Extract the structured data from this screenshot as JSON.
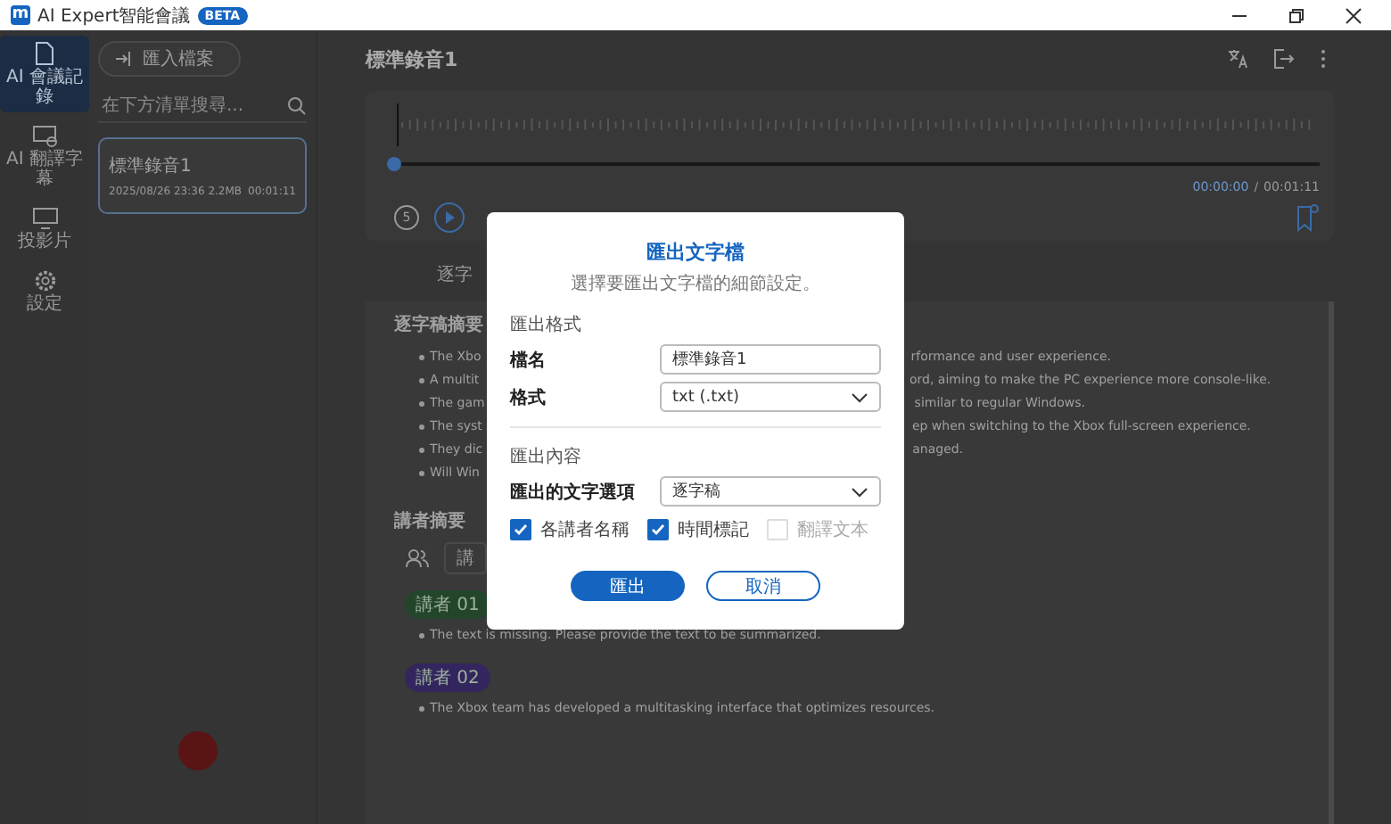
{
  "app": {
    "logo": "m",
    "title": "AI Expert智能會議",
    "badge": "BETA"
  },
  "nav": [
    {
      "label": "AI 會議記錄",
      "selected": true
    },
    {
      "label": "AI 翻譯字幕",
      "selected": false
    },
    {
      "label": "投影片",
      "selected": false
    },
    {
      "label": "設定",
      "selected": false
    }
  ],
  "list": {
    "import_button": "匯入檔案",
    "search": {
      "placeholder": "在下方清單搜尋..."
    },
    "recordings": [
      {
        "name": "標準錄音1",
        "meta": "2025/08/26 23:36 2.2MB",
        "duration": "00:01:11",
        "selected": true
      }
    ]
  },
  "recording": {
    "title": "標準錄音1",
    "player": {
      "level": 0,
      "current": "00:00:00",
      "separator": "/",
      "total": "00:01:11",
      "replay": "5"
    },
    "tab": "逐字",
    "summary": {
      "heading": "逐字稿摘要",
      "bullets": [
        {
          "start": "The Xbo",
          "end": "rformance and user experience."
        },
        {
          "start": "A multit",
          "end": "ord, aiming to make the PC experience more console-like."
        },
        {
          "start": "The gam",
          "end": "similar to regular Windows."
        },
        {
          "start": "The syst",
          "end": "ep when switching to the Xbox full-screen experience."
        },
        {
          "start": "They dic",
          "end": "anaged."
        },
        {
          "start": "Will Win"
        }
      ]
    },
    "speakers": {
      "heading": "講者摘要",
      "field_text": "講",
      "items": [
        {
          "tag": "講者 01",
          "color": "#23452a",
          "bullets": [
            "The text is missing. Please provide the text to be summarized."
          ]
        },
        {
          "tag": "講者 02",
          "color": "#33265e",
          "bullets": [
            "The Xbox team has developed a multitasking interface that optimizes resources."
          ]
        }
      ]
    }
  },
  "dialog": {
    "title": "匯出文字檔",
    "subtitle": "選擇要匯出文字檔的細節設定。",
    "format_section": "匯出格式",
    "filename_label": "檔名",
    "filename_value": "標準錄音1",
    "format_label": "格式",
    "format_value": "txt (.txt)",
    "content_section": "匯出內容",
    "text_option_label": "匯出的文字選項",
    "text_option_value": "逐字稿",
    "checkboxes": [
      {
        "label": "各講者名稱",
        "checked": true,
        "disabled": false
      },
      {
        "label": "時間標記",
        "checked": true,
        "disabled": false
      },
      {
        "label": "翻譯文本",
        "checked": false,
        "disabled": true
      }
    ],
    "buttons": [
      {
        "label": "匯出",
        "kind": "primary"
      },
      {
        "label": "取消",
        "kind": "secondary"
      }
    ]
  }
}
